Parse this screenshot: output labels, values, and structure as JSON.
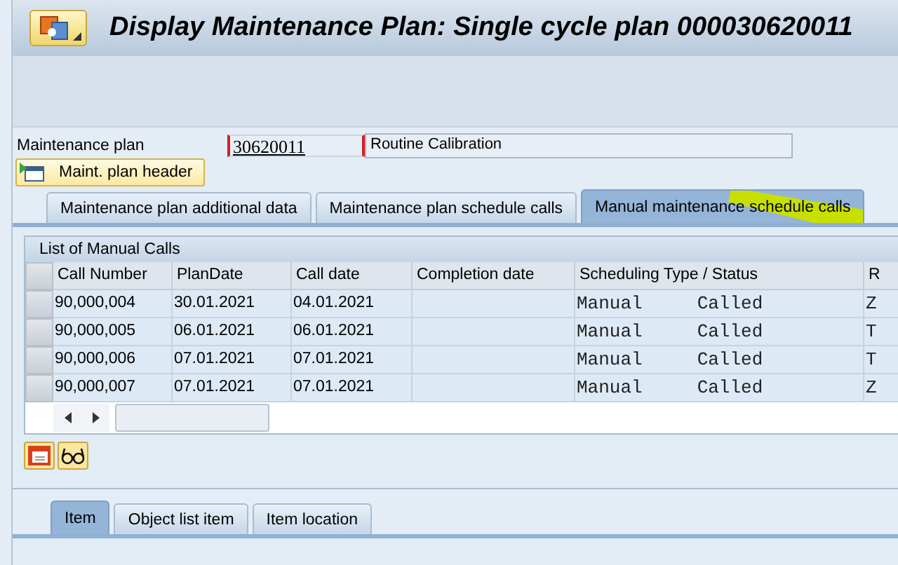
{
  "window": {
    "title": "Display Maintenance Plan: Single cycle plan 000030620011"
  },
  "plan_field": {
    "label": "Maintenance plan",
    "value": "30620011",
    "description": "Routine Calibration"
  },
  "header_button": {
    "label": "Maint. plan header"
  },
  "tabs": [
    {
      "label": "Maintenance plan additional data",
      "selected": false
    },
    {
      "label": "Maintenance plan schedule calls",
      "selected": false
    },
    {
      "label": "Manual maintenance schedule calls",
      "selected": true
    }
  ],
  "table": {
    "title": "List of Manual Calls",
    "columns": [
      "Call Number",
      "PlanDate",
      "Call date",
      "Completion date",
      "Scheduling Type / Status",
      "R"
    ],
    "rows": [
      {
        "cells": [
          "90,000,004",
          "30.01.2021",
          "04.01.2021",
          "",
          "Manual     Called",
          "Z"
        ]
      },
      {
        "cells": [
          "90,000,005",
          "06.01.2021",
          "06.01.2021",
          "",
          "Manual     Called",
          "T"
        ]
      },
      {
        "cells": [
          "90,000,006",
          "07.01.2021",
          "07.01.2021",
          "",
          "Manual     Called",
          "T"
        ]
      },
      {
        "cells": [
          "90,000,007",
          "07.01.2021",
          "07.01.2021",
          "",
          "Manual     Called",
          "Z"
        ]
      }
    ]
  },
  "bottom_tabs": [
    {
      "label": "Item",
      "selected": true
    },
    {
      "label": "Object list item",
      "selected": false
    },
    {
      "label": "Item location",
      "selected": false
    }
  ]
}
